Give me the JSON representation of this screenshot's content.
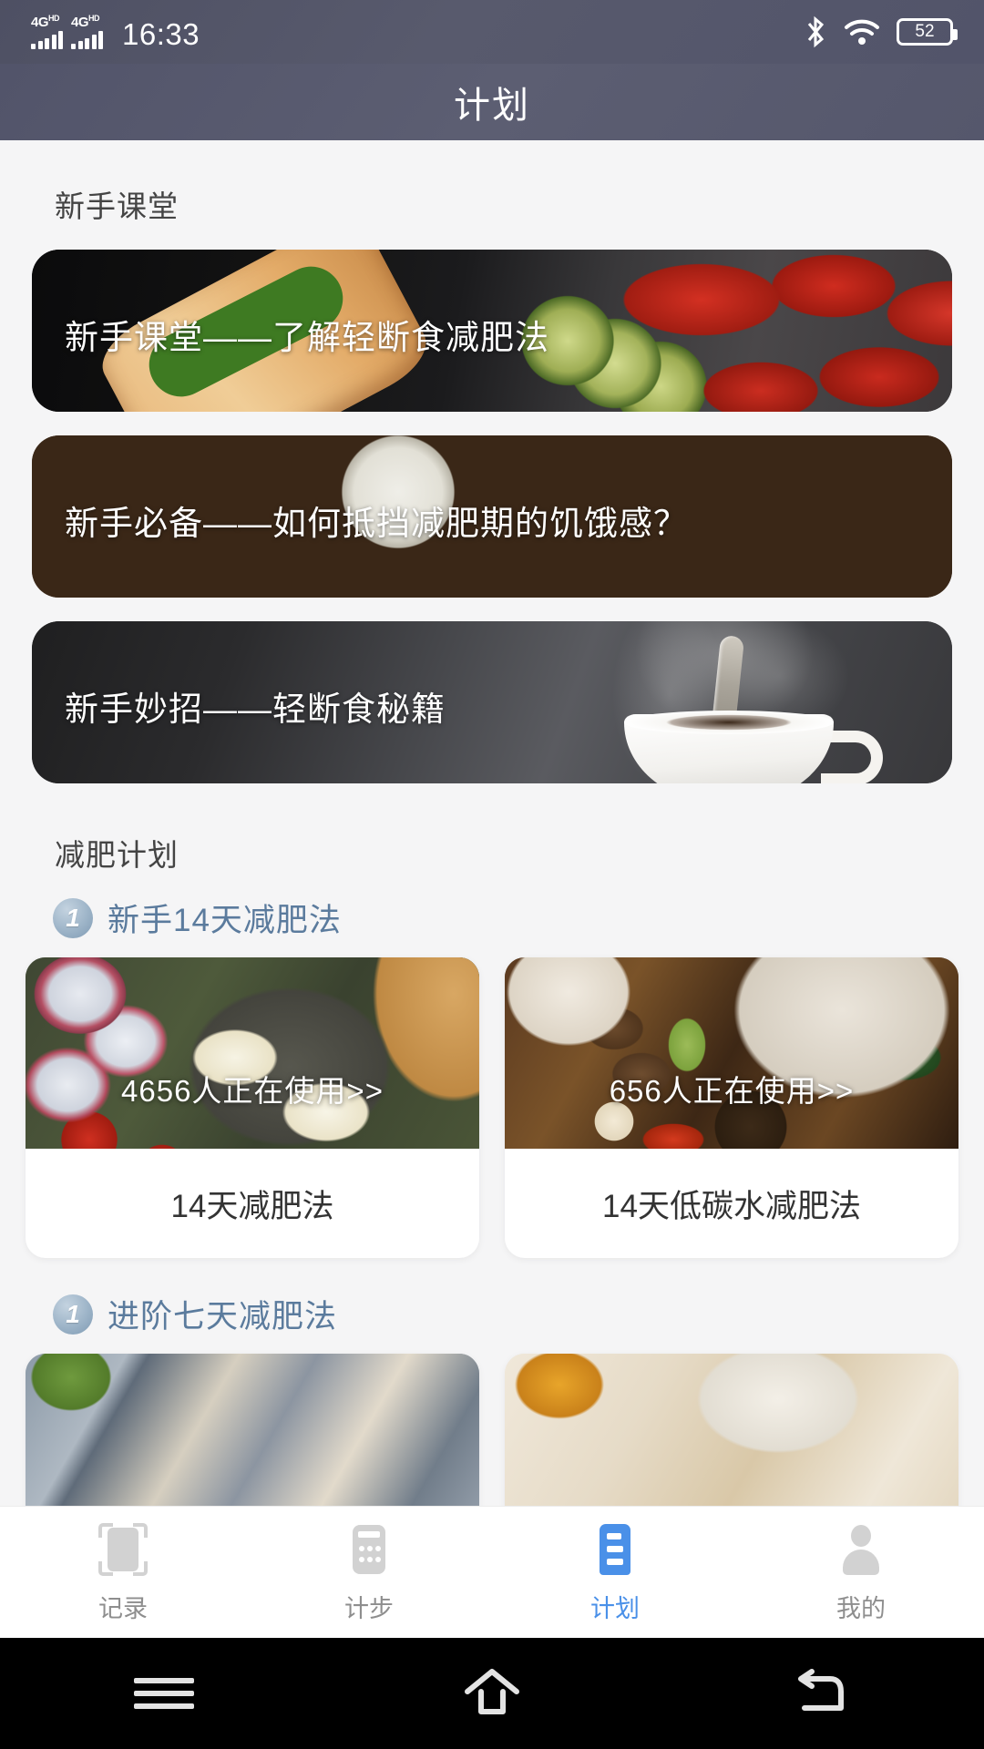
{
  "status_bar": {
    "network_1": "4G",
    "network_1_sup": "HD",
    "network_2": "4G",
    "network_2_sup": "HD",
    "time": "16:33",
    "bluetooth_icon": "bluetooth-icon",
    "wifi_icon": "wifi-icon",
    "battery_level": "52"
  },
  "app_bar": {
    "title": "计划"
  },
  "sections": {
    "beginner": {
      "title": "新手课堂",
      "banners": [
        {
          "caption": "新手课堂——了解轻断食减肥法"
        },
        {
          "caption": "新手必备——如何抵挡减肥期的饥饿感？"
        },
        {
          "caption": "新手妙招——轻断食秘籍"
        }
      ]
    },
    "plans": {
      "title": "减肥计划",
      "groups": [
        {
          "badge": "1",
          "heading": "新手14天减肥法",
          "cards": [
            {
              "users": "4656人正在使用>>",
              "name": "14天减肥法"
            },
            {
              "users": "656人正在使用>>",
              "name": "14天低碳水减肥法"
            }
          ]
        },
        {
          "badge": "1",
          "heading": "进阶七天减肥法",
          "cards": [
            {
              "users": "",
              "name": ""
            },
            {
              "users": "",
              "name": ""
            }
          ]
        }
      ]
    }
  },
  "tab_bar": {
    "active_color": "#4a90e8",
    "inactive_color": "#8e8e8e",
    "tabs": [
      {
        "label": "记录",
        "icon": "record-scan-icon",
        "active": false
      },
      {
        "label": "计步",
        "icon": "pedometer-icon",
        "active": false
      },
      {
        "label": "计划",
        "icon": "plan-document-icon",
        "active": true
      },
      {
        "label": "我的",
        "icon": "profile-person-icon",
        "active": false
      }
    ]
  },
  "nav_bar": {
    "menu": "menu-icon",
    "home": "home-icon",
    "back": "back-icon"
  }
}
